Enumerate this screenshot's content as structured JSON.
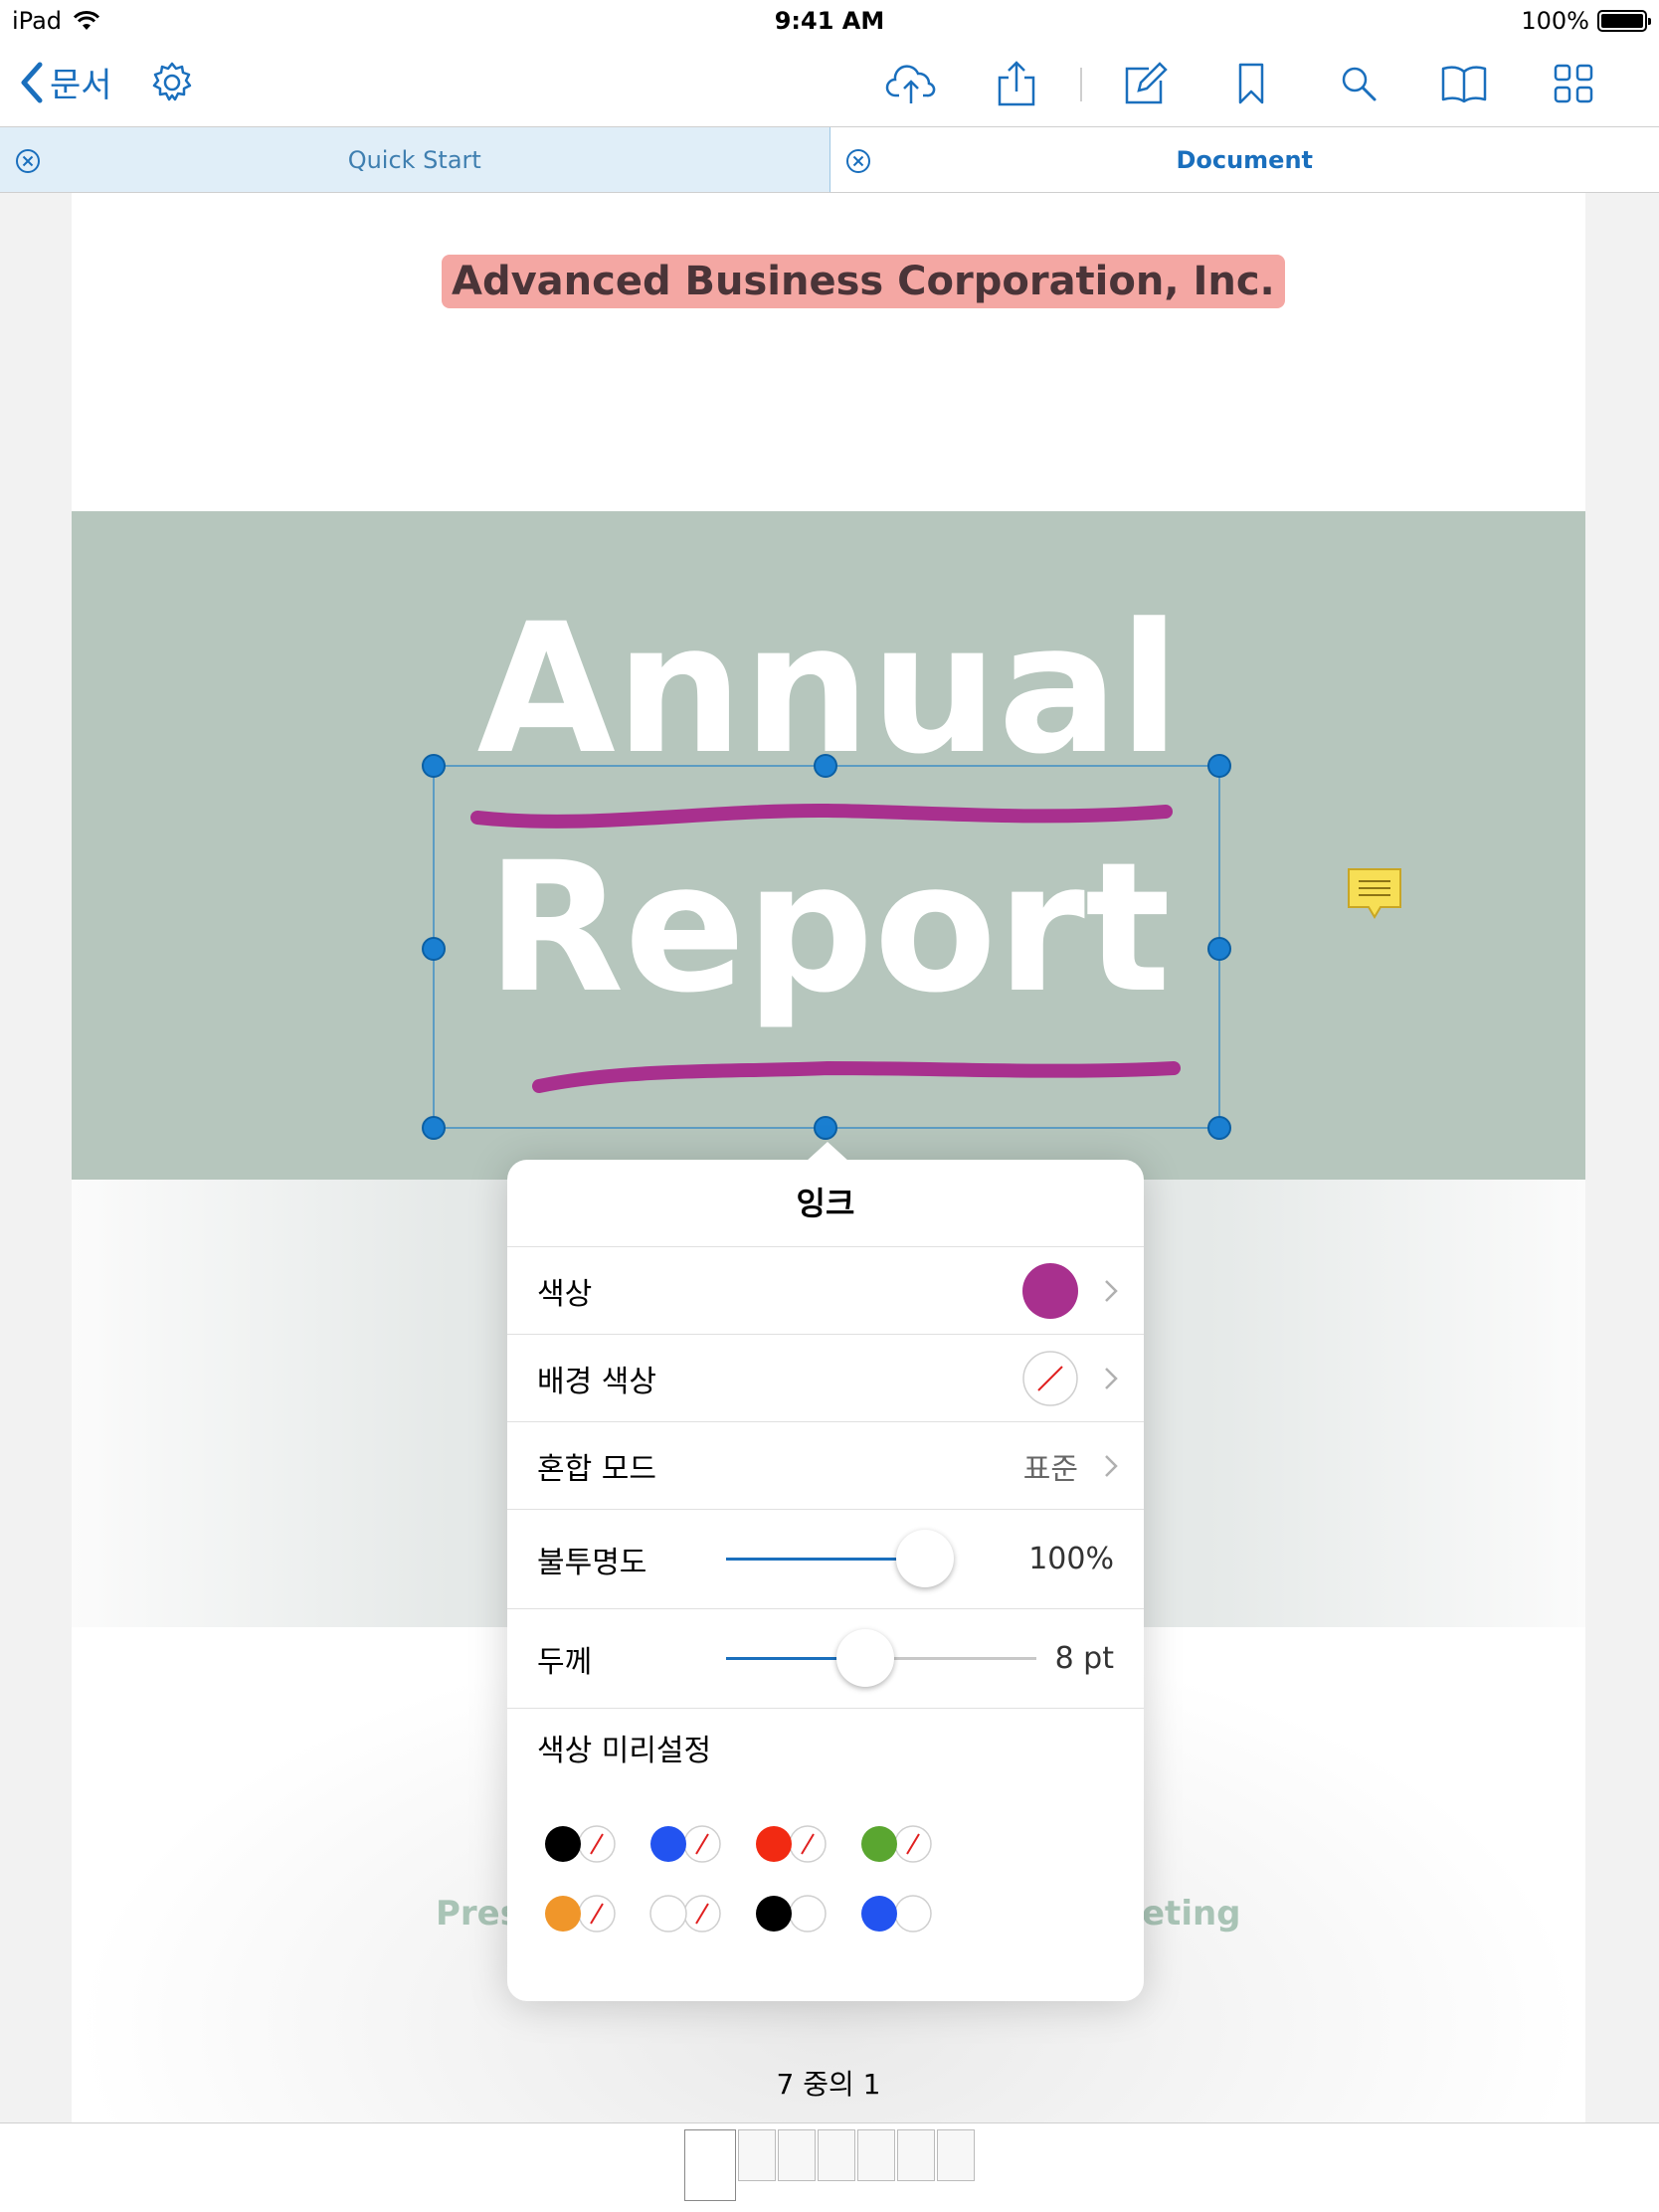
{
  "status": {
    "device": "iPad",
    "time": "9:41 AM",
    "battery": "100%"
  },
  "nav": {
    "back_label": "문서"
  },
  "tabs": [
    {
      "label": "Quick Start"
    },
    {
      "label": "Document"
    }
  ],
  "document": {
    "company": "Advanced Business Corporation, Inc.",
    "title_line1": "Annual",
    "title_line2": "Report",
    "partial_left": "Pres",
    "partial_right": "eting",
    "page_indicator": "7 중의 1"
  },
  "popover": {
    "title": "잉크",
    "color_label": "색상",
    "background_label": "배경 색상",
    "blend_label": "혼합 모드",
    "blend_value": "표준",
    "opacity_label": "불투명도",
    "opacity_value": "100%",
    "opacity_level": 1.0,
    "thickness_label": "두께",
    "thickness_value": "8 pt",
    "thickness_level": 0.45,
    "presets_label": "색상 미리설정",
    "ink_color": "#a8308e",
    "presets": [
      {
        "color": "#000000",
        "bg": "none"
      },
      {
        "color": "#2253f0",
        "bg": "none"
      },
      {
        "color": "#f22a12",
        "bg": "none"
      },
      {
        "color": "#5aa630",
        "bg": "none"
      },
      {
        "color": "#f0962a",
        "bg": "none"
      },
      {
        "color": "#ffffff",
        "bg": "none"
      },
      {
        "color": "#000000",
        "bg": "#ffffff"
      },
      {
        "color": "#2253f0",
        "bg": "#ffffff"
      }
    ]
  },
  "colors": {
    "accent": "#1a6fbd",
    "banner": "#b6c6bd",
    "highlight": "#f4a7a3"
  }
}
